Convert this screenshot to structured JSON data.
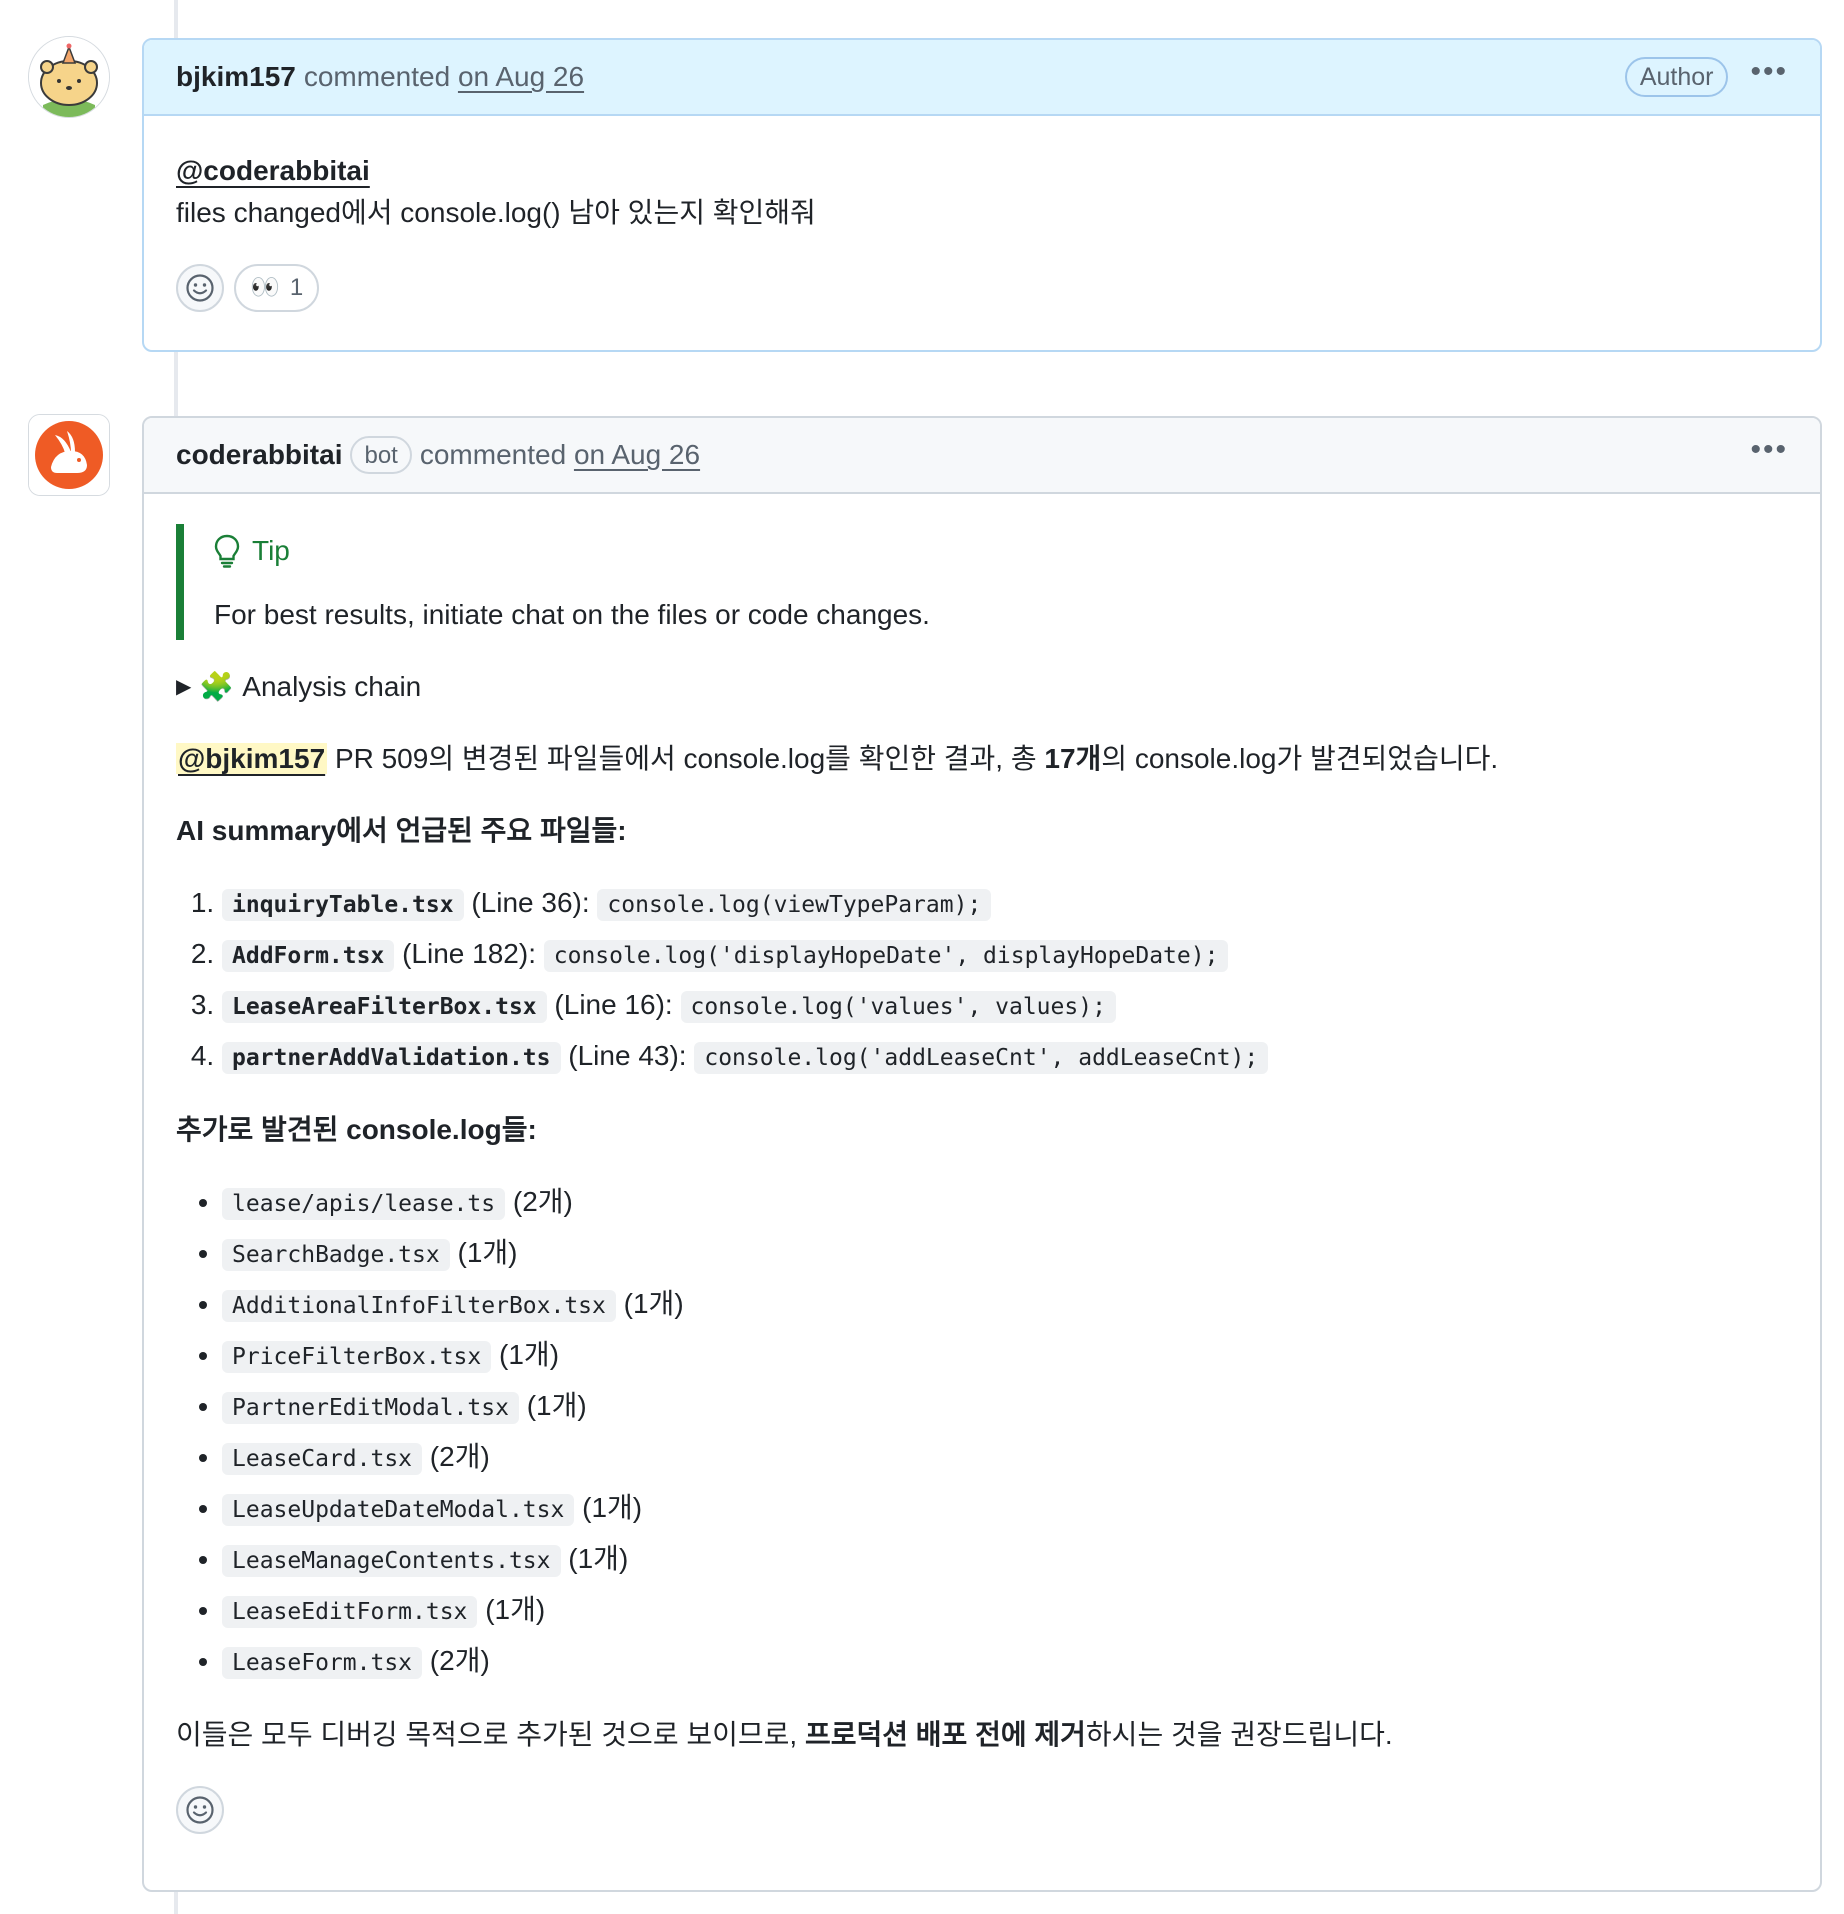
{
  "comment1": {
    "username": "bjkim157",
    "commented": "commented",
    "date": "on Aug 26",
    "badge": "Author",
    "more": "•••",
    "mention": "@coderabbitai",
    "text": "files changed에서 console.log() 남아 있는지 확인해줘",
    "reaction": {
      "emoji": "👀",
      "count": "1"
    }
  },
  "comment2": {
    "username": "coderabbitai",
    "badge": "bot",
    "commented": "commented",
    "date": "on Aug 26",
    "more": "•••",
    "tip": {
      "title": "Tip",
      "text": "For best results, initiate chat on the files or code changes."
    },
    "details": {
      "marker": "▶",
      "emoji": "🧩",
      "summary": "Analysis chain"
    },
    "intro": {
      "mention": "@bjkim157",
      "pre": "PR 509의 변경된 파일들에서 console.log를 확인한 결과, 총 ",
      "count": "17개",
      "post": "의 console.log가 발견되었습니다."
    },
    "main_heading": "AI summary에서 언급된 주요 파일들:",
    "main_files": [
      {
        "file": "inquiryTable.tsx",
        "line": "(Line 36):",
        "code": "console.log(viewTypeParam);"
      },
      {
        "file": "AddForm.tsx",
        "line": "(Line 182):",
        "code": "console.log('displayHopeDate', displayHopeDate);"
      },
      {
        "file": "LeaseAreaFilterBox.tsx",
        "line": "(Line 16):",
        "code": "console.log('values', values);"
      },
      {
        "file": "partnerAddValidation.ts",
        "line": "(Line 43):",
        "code": "console.log('addLeaseCnt', addLeaseCnt);"
      }
    ],
    "extra_heading": "추가로 발견된 console.log들:",
    "extra_files": [
      {
        "file": "lease/apis/lease.ts",
        "count": "(2개)"
      },
      {
        "file": "SearchBadge.tsx",
        "count": "(1개)"
      },
      {
        "file": "AdditionalInfoFilterBox.tsx",
        "count": "(1개)"
      },
      {
        "file": "PriceFilterBox.tsx",
        "count": "(1개)"
      },
      {
        "file": "PartnerEditModal.tsx",
        "count": "(1개)"
      },
      {
        "file": "LeaseCard.tsx",
        "count": "(2개)"
      },
      {
        "file": "LeaseUpdateDateModal.tsx",
        "count": "(1개)"
      },
      {
        "file": "LeaseManageContents.tsx",
        "count": "(1개)"
      },
      {
        "file": "LeaseEditForm.tsx",
        "count": "(1개)"
      },
      {
        "file": "LeaseForm.tsx",
        "count": "(2개)"
      }
    ],
    "conclusion": {
      "pre": "이들은 모두 디버깅 목적으로 추가된 것으로 보이므로, ",
      "bold": "프로덕션 배포 전에 제거",
      "post": "하시는 것을 권장드립니다."
    }
  },
  "colors": {
    "tip_green": "#1a7f37",
    "author_header": "#ddf4ff",
    "coderabbit_orange": "#ef5b25"
  }
}
